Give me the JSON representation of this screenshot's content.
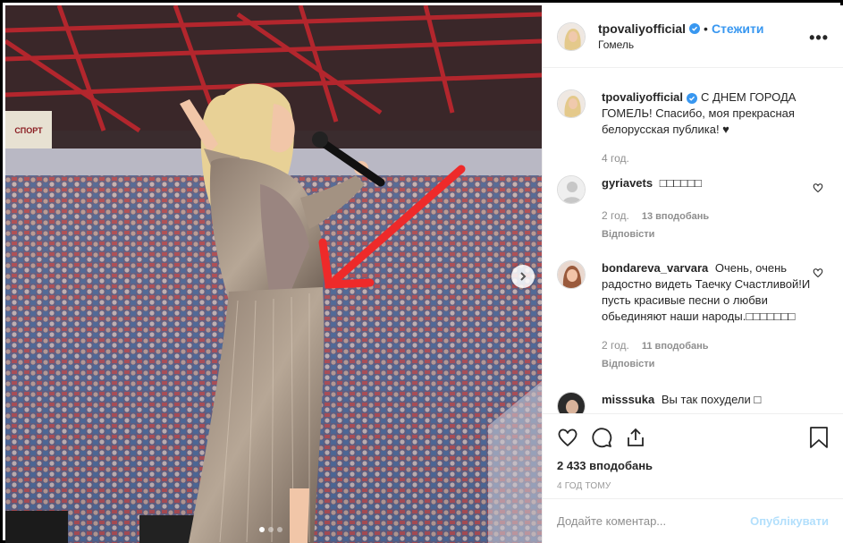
{
  "post": {
    "username": "tpovaliyofficial",
    "separator": "•",
    "follow_label": "Стежити",
    "location": "Гомель",
    "more_icon": "more-options-icon"
  },
  "caption": {
    "username": "tpovaliyofficial",
    "text": "С ДНЕМ ГОРОДА ГОМЕЛЬ! Спасибо, моя прекрасная белорусская публика! ♥",
    "time": "4 год."
  },
  "comments": [
    {
      "username": "gyriavets",
      "text": "□□□□□□",
      "time": "2 год.",
      "likes": "13 вподобань",
      "reply": "Відповісти"
    },
    {
      "username": "bondareva_varvara",
      "text": "Очень, очень радостно видеть Таечку Счастливой!И пусть красивые песни о любви обьединяют наши народы.□□□□□□□",
      "time": "2 год.",
      "likes": "11 вподобань",
      "reply": "Відповісти"
    },
    {
      "username": "misssuka",
      "text": "Вы так похудели □"
    }
  ],
  "actions": {
    "likes_count": "2 433 вподобань",
    "time_ago": "4 ГОД ТОМУ",
    "comment_placeholder": "Додайте коментар...",
    "publish_label": "Опублікувати"
  },
  "colors": {
    "accent": "#3897f0",
    "arrow": "#ee2a2a",
    "stadium_steel": "#b3262d"
  }
}
